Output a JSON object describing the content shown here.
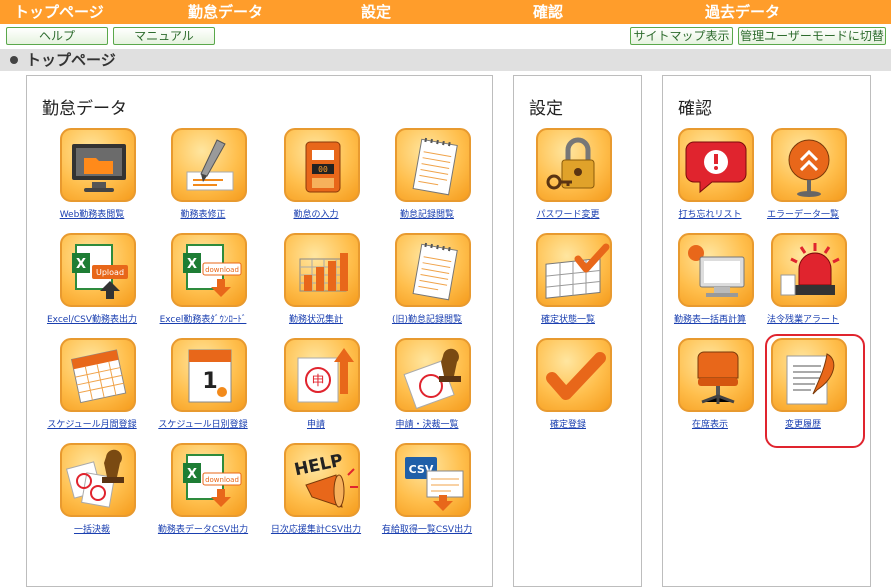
{
  "topnav": {
    "items": [
      "トップページ",
      "勤怠データ",
      "設定",
      "確認",
      "過去データ"
    ]
  },
  "toolbar": {
    "help": "ヘルプ",
    "manual": "マニュアル",
    "sitemap": "サイトマップ表示",
    "admin_mode": "管理ユーザーモードに切替"
  },
  "breadcrumb": "トップページ",
  "sections": {
    "attendance": {
      "title": "勤怠データ",
      "tiles": [
        {
          "label": "Web勤務表閲覧",
          "icon": "monitor-folder-icon"
        },
        {
          "label": "勤務表修正",
          "icon": "pencil-edit-icon"
        },
        {
          "label": "勤怠の入力",
          "icon": "time-clock-icon"
        },
        {
          "label": "勤怠記録閲覧",
          "icon": "notepad-icon"
        },
        {
          "label": "Excel/CSV勤務表出力",
          "icon": "excel-upload-icon"
        },
        {
          "label": "Excel勤務表ﾀﾞｳﾝﾛｰﾄﾞ",
          "icon": "excel-download-icon"
        },
        {
          "label": "勤務状況集計",
          "icon": "bar-chart-icon"
        },
        {
          "label": "(旧)勤怠記録閲覧",
          "icon": "notepad-icon"
        },
        {
          "label": "スケジュール月間登録",
          "icon": "calendar-month-icon"
        },
        {
          "label": "スケジュール日別登録",
          "icon": "calendar-day-icon"
        },
        {
          "label": "申請",
          "icon": "application-stamp-icon"
        },
        {
          "label": "申請・決裁一覧",
          "icon": "approval-stamp-icon"
        },
        {
          "label": "一括決裁",
          "icon": "bulk-approval-icon"
        },
        {
          "label": "勤務表データCSV出力",
          "icon": "excel-download-icon"
        },
        {
          "label": "日次応援集計CSV出力",
          "icon": "help-megaphone-icon"
        },
        {
          "label": "有給取得一覧CSV出力",
          "icon": "csv-export-icon"
        }
      ]
    },
    "settings": {
      "title": "設定",
      "tiles": [
        {
          "label": "パスワード変更",
          "icon": "padlock-key-icon"
        },
        {
          "label": "確定状態一覧",
          "icon": "grid-check-icon"
        },
        {
          "label": "確定登録",
          "icon": "checkmark-icon"
        }
      ]
    },
    "confirm": {
      "title": "確認",
      "tiles": [
        {
          "label": "打ち忘れリスト",
          "icon": "alert-speech-icon"
        },
        {
          "label": "エラーデータ一覧",
          "icon": "error-badge-icon"
        },
        {
          "label": "勤務表一括再計算",
          "icon": "recalculate-monitor-icon"
        },
        {
          "label": "法令残業アラート",
          "icon": "siren-alert-icon"
        },
        {
          "label": "在席表示",
          "icon": "office-chair-icon"
        },
        {
          "label": "変更履歴",
          "icon": "scroll-quill-icon"
        }
      ]
    }
  },
  "colors": {
    "topnav_bg": "#ff9d2b",
    "breadcrumb_bg": "#e0e0e0",
    "button_border": "#5aa84b",
    "link": "#1a3fb0",
    "highlight": "#e0242e"
  }
}
